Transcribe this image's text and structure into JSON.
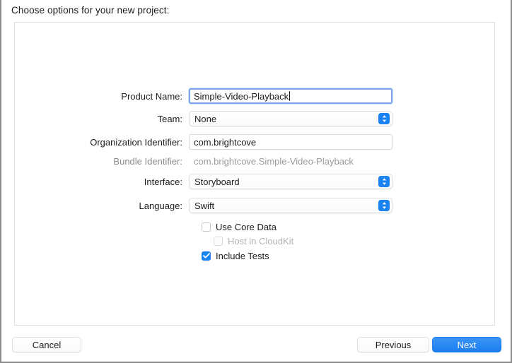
{
  "sheet": {
    "title": "Choose options for your new project:"
  },
  "form": {
    "rows": [
      {
        "label": "Product Name:",
        "type": "textfield",
        "value": "Simple-Video-Playback",
        "placeholder": "",
        "focused": true
      },
      {
        "label": "Team:",
        "type": "popup",
        "value": "None"
      },
      {
        "label": "Organization Identifier:",
        "type": "textfield",
        "value": "com.brightcove",
        "placeholder": "",
        "focused": false
      },
      {
        "label": "Bundle Identifier:",
        "type": "static",
        "value": "com.brightcove.Simple-Video-Playback"
      },
      {
        "label": "Interface:",
        "type": "popup",
        "value": "Storyboard"
      },
      {
        "label": "Language:",
        "type": "popup",
        "value": "Swift"
      }
    ],
    "checkboxes": [
      {
        "label": "Use Core Data",
        "checked": false,
        "disabled": false,
        "indented": false
      },
      {
        "label": "Host in CloudKit",
        "checked": false,
        "disabled": true,
        "indented": true
      },
      {
        "label": "Include Tests",
        "checked": true,
        "disabled": false,
        "indented": false
      }
    ]
  },
  "footer": {
    "cancel_label": "Cancel",
    "previous_label": "Previous",
    "next_label": "Next"
  },
  "colors": {
    "accent": "#1b82f2",
    "primary_button": "#1b7df0",
    "focus_ring": "#7aa7e8",
    "text": "#1d1d1f",
    "dim_text": "#9b9b9f",
    "panel_border": "#e0e0e0",
    "window_border": "#8c8c8c"
  }
}
